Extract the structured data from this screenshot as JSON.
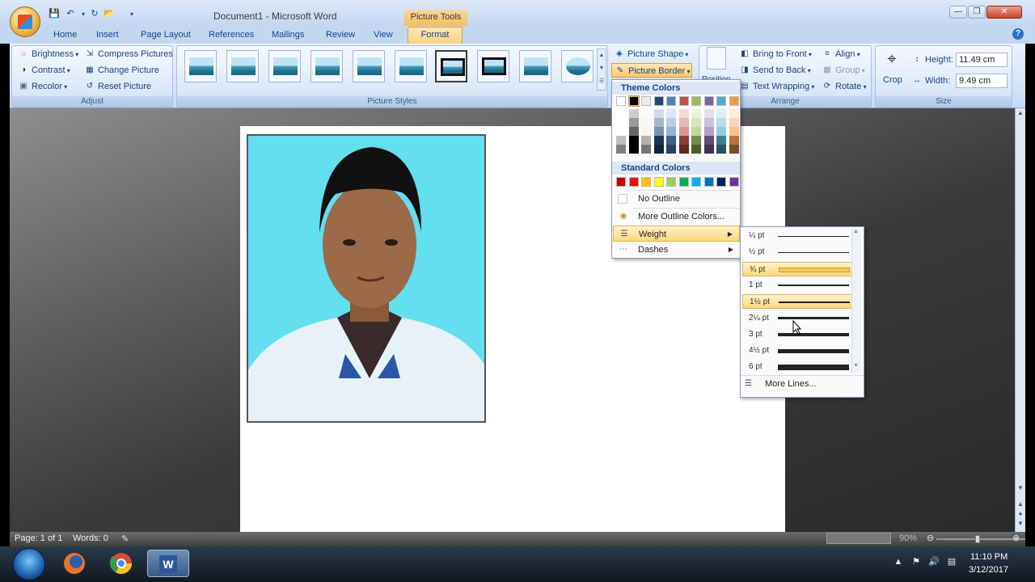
{
  "window": {
    "title": "Document1 - Microsoft Word",
    "context_tab_title": "Picture Tools"
  },
  "tabs": [
    "Home",
    "Insert",
    "Page Layout",
    "References",
    "Mailings",
    "Review",
    "View",
    "Format"
  ],
  "ribbon": {
    "adjust": {
      "label": "Adjust",
      "brightness": "Brightness",
      "contrast": "Contrast",
      "recolor": "Recolor",
      "compress": "Compress Pictures",
      "change": "Change Picture",
      "reset": "Reset Picture"
    },
    "styles": {
      "label": "Picture Styles"
    },
    "picture_shape": "Picture Shape",
    "picture_border": "Picture Border",
    "arrange": {
      "label": "Arrange",
      "position": "Position",
      "bring_front": "Bring to Front",
      "send_back": "Send to Back",
      "text_wrapping": "Text Wrapping",
      "align": "Align",
      "group": "Group",
      "rotate": "Rotate"
    },
    "size": {
      "label": "Size",
      "crop": "Crop",
      "height_label": "Height:",
      "height_value": "11.49 cm",
      "width_label": "Width:",
      "width_value": "9.49 cm"
    }
  },
  "border_menu": {
    "theme_colors_header": "Theme Colors",
    "standard_colors_header": "Standard Colors",
    "theme_colors": [
      "#ffffff",
      "#000000",
      "#eeece1",
      "#1f497d",
      "#4f81bd",
      "#c0504d",
      "#9bbb59",
      "#8064a2",
      "#4bacc6",
      "#f79646"
    ],
    "standard_colors": [
      "#c00000",
      "#ff0000",
      "#ffc000",
      "#ffff00",
      "#92d050",
      "#00b050",
      "#00b0f0",
      "#0070c0",
      "#002060",
      "#7030a0"
    ],
    "no_outline": "No Outline",
    "more_colors": "More Outline Colors...",
    "weight": "Weight",
    "dashes": "Dashes"
  },
  "weight_menu": {
    "items": [
      "¼ pt",
      "½ pt",
      "¾ pt",
      "1 pt",
      "1½ pt",
      "2¼ pt",
      "3 pt",
      "4½ pt",
      "6 pt"
    ],
    "more_lines": "More Lines..."
  },
  "status": {
    "page": "Page: 1 of 1",
    "words": "Words: 0",
    "zoom": "90%"
  },
  "taskbar": {
    "time": "11:10 PM",
    "date": "3/12/2017"
  }
}
